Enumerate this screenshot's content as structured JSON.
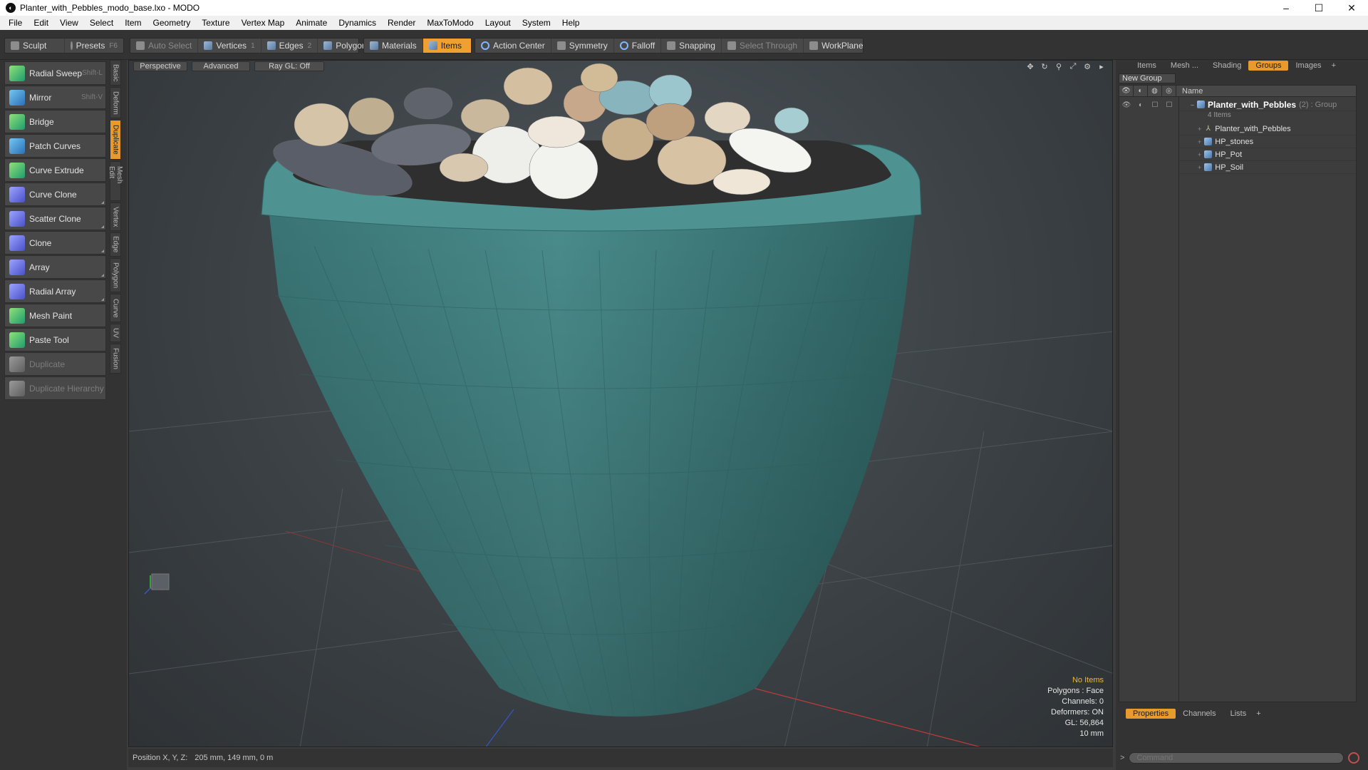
{
  "window": {
    "title": "Planter_with_Pebbles_modo_base.lxo - MODO",
    "minimize": "–",
    "maximize": "☐",
    "close": "✕"
  },
  "menu": [
    "File",
    "Edit",
    "View",
    "Select",
    "Item",
    "Geometry",
    "Texture",
    "Vertex Map",
    "Animate",
    "Dynamics",
    "Render",
    "MaxToModo",
    "Layout",
    "System",
    "Help"
  ],
  "toolbar": {
    "sculpt": "Sculpt",
    "presets": "Presets",
    "presets_key": "F6",
    "auto_select": "Auto Select",
    "vertices": "Vertices",
    "vertices_count": "1",
    "edges": "Edges",
    "edges_count": "2",
    "polygons": "Polygons",
    "materials": "Materials",
    "items": "Items",
    "action_center": "Action Center",
    "symmetry": "Symmetry",
    "falloff": "Falloff",
    "snapping": "Snapping",
    "select_through": "Select Through",
    "workplane": "WorkPlane"
  },
  "tools": [
    {
      "label": "Radial Sweep",
      "shortcut": "Shift-L",
      "icon": "radial-sweep-icon",
      "enabled": true
    },
    {
      "label": "Mirror",
      "shortcut": "Shift-V",
      "icon": "mirror-icon",
      "enabled": true
    },
    {
      "label": "Bridge",
      "shortcut": "",
      "icon": "bridge-icon",
      "enabled": true
    },
    {
      "label": "Patch Curves",
      "shortcut": "",
      "icon": "patch-curves-icon",
      "enabled": true
    },
    {
      "label": "Curve Extrude",
      "shortcut": "",
      "icon": "curve-extrude-icon",
      "enabled": true
    },
    {
      "label": "Curve Clone",
      "shortcut": "",
      "icon": "curve-clone-icon",
      "enabled": true
    },
    {
      "label": "Scatter Clone",
      "shortcut": "",
      "icon": "scatter-clone-icon",
      "enabled": true
    },
    {
      "label": "Clone",
      "shortcut": "",
      "icon": "clone-icon",
      "enabled": true
    },
    {
      "label": "Array",
      "shortcut": "",
      "icon": "array-icon",
      "enabled": true
    },
    {
      "label": "Radial Array",
      "shortcut": "",
      "icon": "radial-array-icon",
      "enabled": true
    },
    {
      "label": "Mesh Paint",
      "shortcut": "",
      "icon": "mesh-paint-icon",
      "enabled": true
    },
    {
      "label": "Paste Tool",
      "shortcut": "",
      "icon": "paste-tool-icon",
      "enabled": true
    },
    {
      "label": "Duplicate",
      "shortcut": "",
      "icon": "duplicate-icon",
      "enabled": false
    },
    {
      "label": "Duplicate Hierarchy",
      "shortcut": "",
      "icon": "duplicate-hierarchy-icon",
      "enabled": false
    }
  ],
  "vtabs": [
    "Basic",
    "Deform",
    "Duplicate",
    "Mesh Edit",
    "Vertex",
    "Edge",
    "Polygon",
    "Curve",
    "UV",
    "Fusion"
  ],
  "viewport": {
    "tabs": [
      "Perspective",
      "Advanced",
      "Ray GL: Off"
    ],
    "info": {
      "no_items": "No Items",
      "polygons": "Polygons : Face",
      "channels": "Channels: 0",
      "deformers": "Deformers: ON",
      "gl": "GL: 56,864",
      "scale": "10 mm"
    }
  },
  "status": {
    "label": "Position X, Y, Z:",
    "value": "205 mm, 149 mm, 0 m"
  },
  "right_panel": {
    "tabs": [
      "Items",
      "Mesh ...",
      "Shading",
      "Groups",
      "Images",
      "+"
    ],
    "active_tab": "Groups",
    "new_group": "New Group",
    "col_name": "Name",
    "group_name": "Planter_with_Pebbles",
    "group_suffix": "(2) : Group",
    "group_count": "4 Items",
    "children": [
      "Planter_with_Pebbles",
      "HP_stones",
      "HP_Pot",
      "HP_Soil"
    ],
    "bottom_tabs": [
      "Properties",
      "Channels",
      "Lists",
      "+"
    ],
    "command_placeholder": "Command"
  },
  "colors": {
    "accent": "#e89a2c",
    "pot": "#3f7f80",
    "info_warn": "#f2b43a"
  }
}
